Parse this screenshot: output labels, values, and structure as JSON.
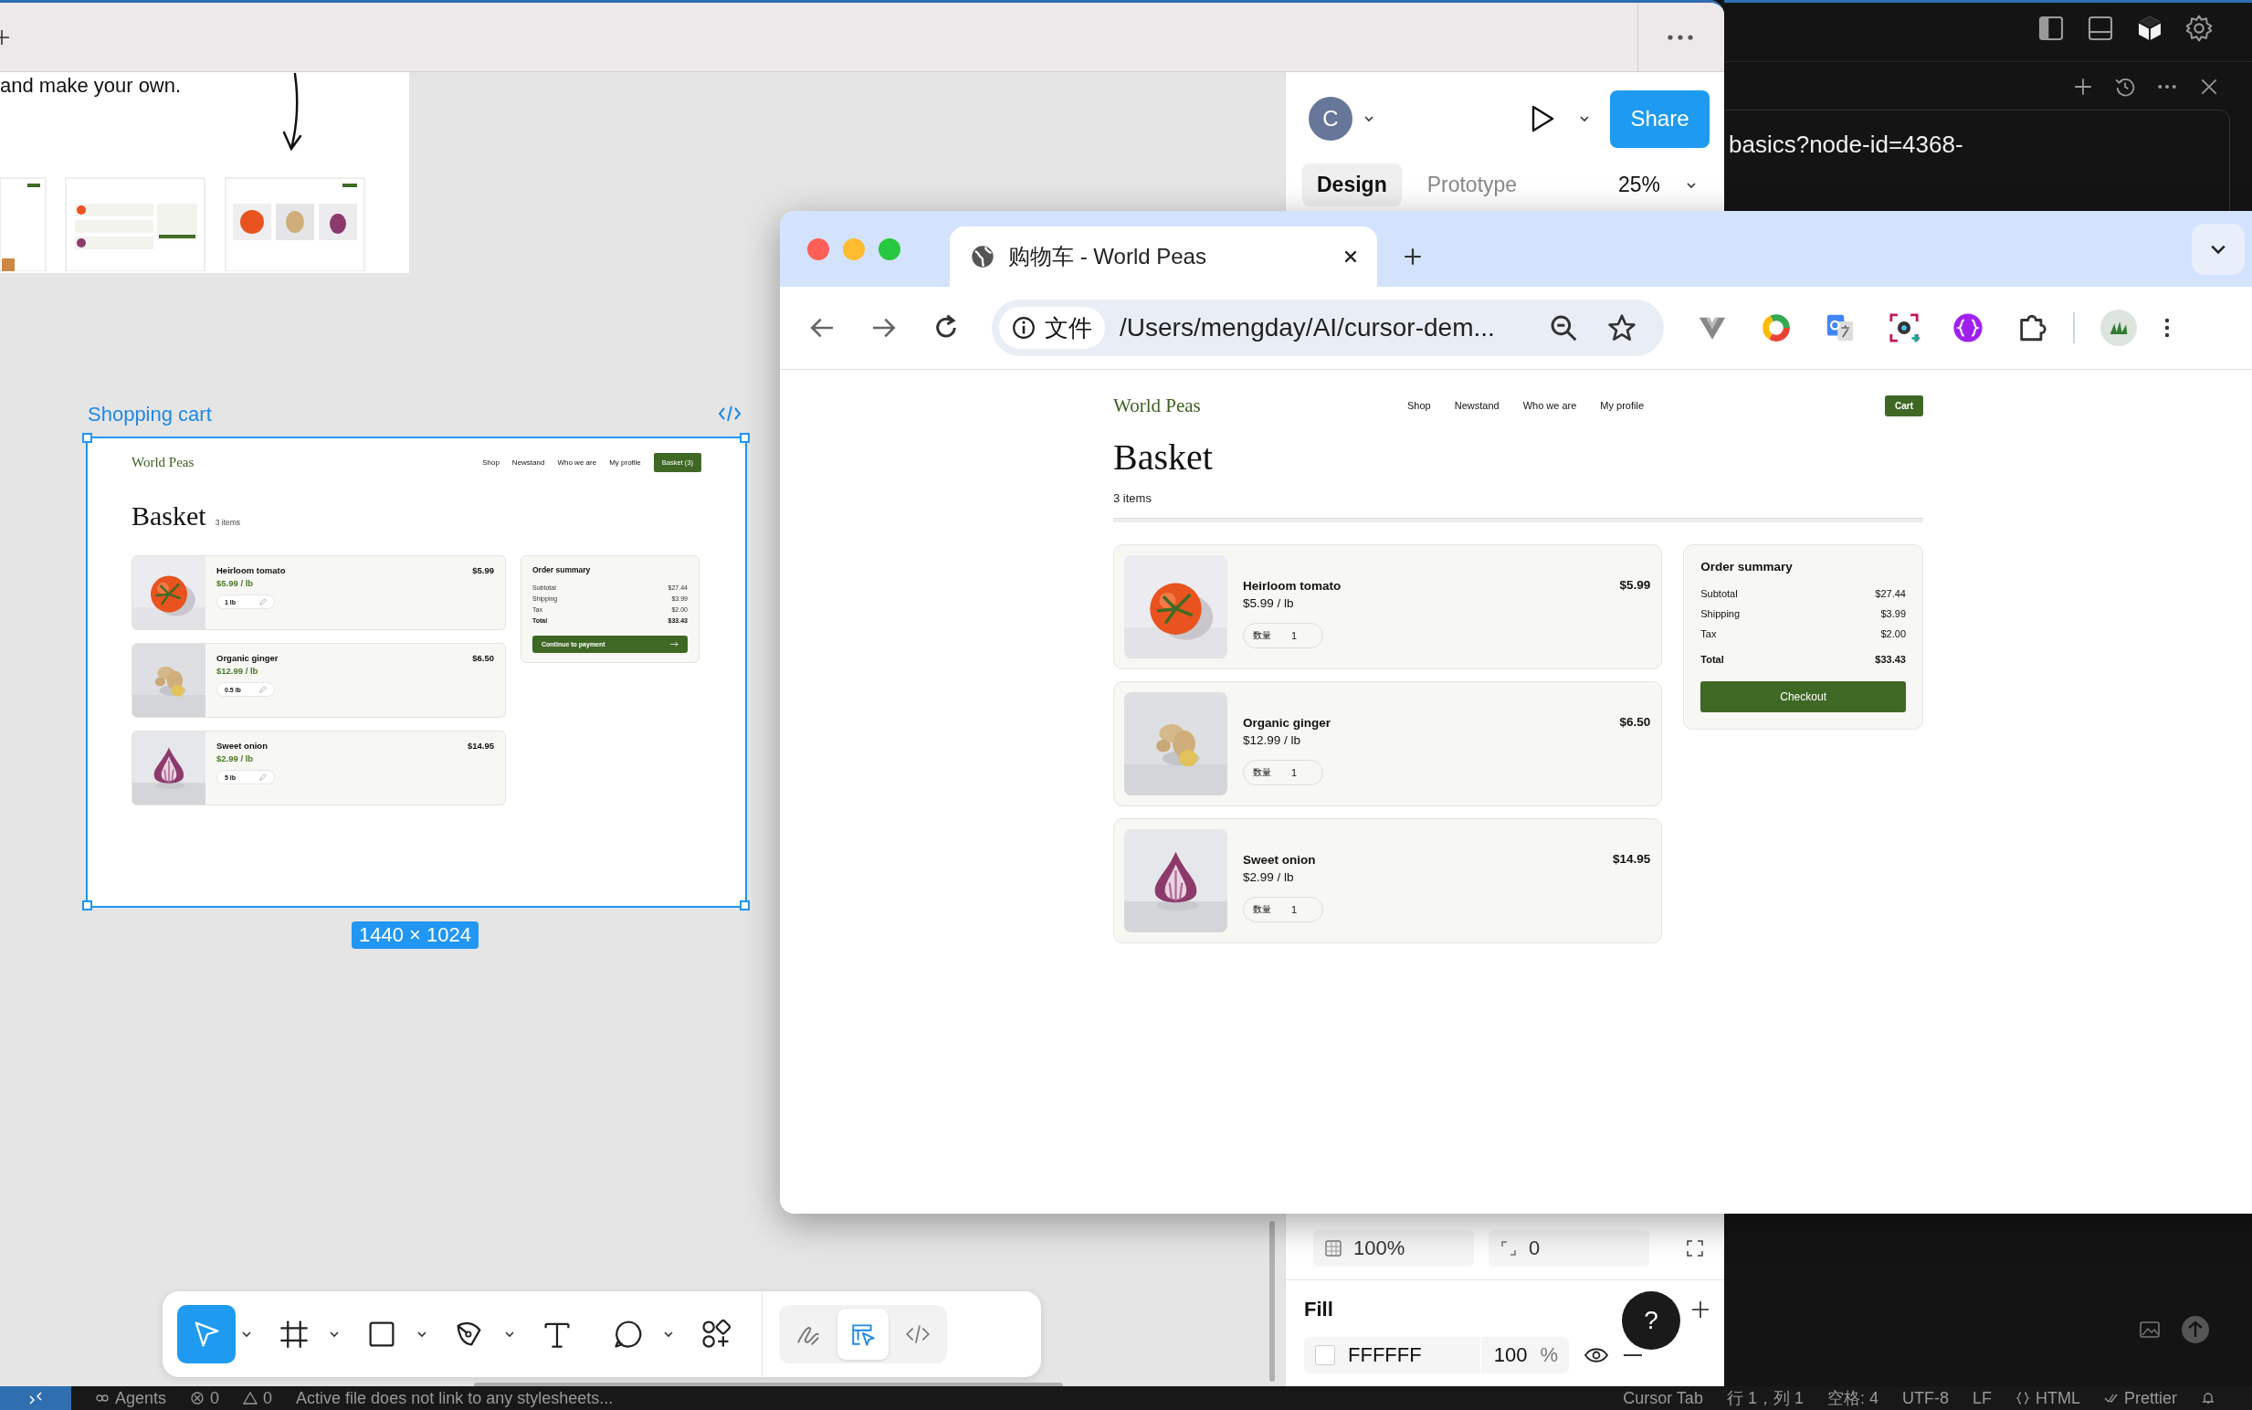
{
  "figma": {
    "canvas": {
      "intro_text": "and make your own.",
      "frame": {
        "name": "Shopping cart",
        "size": "1440 × 1024",
        "selected": true,
        "page": {
          "logo": "World Peas",
          "nav": [
            "Shop",
            "Newstand",
            "Who we are",
            "My profile"
          ],
          "basket_button": "Basket (3)",
          "heading": "Basket",
          "count": "3 items",
          "items": [
            {
              "name": "Heirloom tomato",
              "price": "$5.99",
              "unit_price": "$5.99 / lb",
              "quantity": "1 lb"
            },
            {
              "name": "Organic ginger",
              "price": "$6.50",
              "unit_price": "$12.99 / lb",
              "quantity": "0.5 lb"
            },
            {
              "name": "Sweet onion",
              "price": "$14.95",
              "unit_price": "$2.99 / lb",
              "quantity": "5 lb"
            }
          ],
          "summary": {
            "title": "Order summary",
            "rows": [
              {
                "label": "Subtotal",
                "value": "$27.44",
                "kind": "line"
              },
              {
                "label": "Shipping",
                "value": "$3.99",
                "kind": "line"
              },
              {
                "label": "Tax",
                "value": "$2.00",
                "kind": "line"
              },
              {
                "label": "Total",
                "value": "$33.43",
                "kind": "total"
              }
            ],
            "button": "Continue to payment"
          }
        }
      }
    },
    "toolbar": {
      "tools": [
        {
          "kind": "select",
          "selected": true,
          "menu": true
        },
        {
          "kind": "frame",
          "selected": false,
          "menu": true
        },
        {
          "kind": "rectangle",
          "selected": false,
          "menu": true
        },
        {
          "kind": "pen",
          "selected": false,
          "menu": true
        },
        {
          "kind": "text",
          "selected": false,
          "menu": false
        },
        {
          "kind": "comment",
          "selected": false,
          "menu": true
        },
        {
          "kind": "actions",
          "selected": false,
          "menu": false
        }
      ],
      "modes": [
        {
          "kind": "draw",
          "selected": false
        },
        {
          "kind": "design",
          "selected": true
        },
        {
          "kind": "dev",
          "selected": false
        }
      ]
    },
    "panel": {
      "avatar": "C",
      "share": "Share",
      "tabs": [
        {
          "label": "Design",
          "selected": true
        },
        {
          "label": "Prototype",
          "selected": false
        }
      ],
      "zoom": "25%",
      "layer": {
        "opacity": "100%",
        "radius": "0"
      },
      "fill": {
        "title": "Fill",
        "color": "FFFFFF",
        "opacity": "100",
        "unit": "%",
        "visible": true
      }
    },
    "help": "?"
  },
  "browser": {
    "tab_title": "购物车 - World Peas",
    "address_chip": "文件",
    "url": "/Users/mengday/AI/cursor-dem...",
    "page": {
      "logo": "World Peas",
      "nav": [
        "Shop",
        "Newstand",
        "Who we are",
        "My profile"
      ],
      "cart_button": "Cart",
      "heading": "Basket",
      "count": "3 items",
      "items": [
        {
          "name": "Heirloom tomato",
          "price": "$5.99",
          "unit_price": "$5.99 / lb",
          "quantity_label": "数量",
          "quantity": "1"
        },
        {
          "name": "Organic ginger",
          "price": "$6.50",
          "unit_price": "$12.99 / lb",
          "quantity_label": "数量",
          "quantity": "1"
        },
        {
          "name": "Sweet onion",
          "price": "$14.95",
          "unit_price": "$2.99 / lb",
          "quantity_label": "数量",
          "quantity": "1"
        }
      ],
      "summary": {
        "title": "Order summary",
        "rows": [
          {
            "label": "Subtotal",
            "value": "$27.44",
            "kind": "line"
          },
          {
            "label": "Shipping",
            "value": "$3.99",
            "kind": "line"
          },
          {
            "label": "Tax",
            "value": "$2.00",
            "kind": "line"
          },
          {
            "label": "Total",
            "value": "$33.43",
            "kind": "total"
          }
        ],
        "button": "Checkout"
      }
    }
  },
  "editor": {
    "prompt_text": "basics?node-id=4368-",
    "status_left": [
      {
        "kind": "agents",
        "text": "Agents"
      },
      {
        "kind": "errors",
        "text": "0"
      },
      {
        "kind": "warnings",
        "text": "0"
      },
      {
        "kind": "plain",
        "text": "Active file does not link to any stylesheets..."
      }
    ],
    "status_right": [
      {
        "kind": "plain",
        "text": "Cursor Tab"
      },
      {
        "kind": "plain",
        "text": "行 1，列 1"
      },
      {
        "kind": "plain",
        "text": "空格: 4"
      },
      {
        "kind": "plain",
        "text": "UTF-8"
      },
      {
        "kind": "plain",
        "text": "LF"
      },
      {
        "kind": "braces",
        "text": "HTML"
      },
      {
        "kind": "check",
        "text": "Prettier"
      }
    ]
  }
}
